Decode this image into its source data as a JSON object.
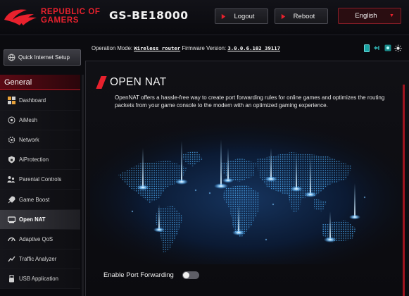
{
  "header": {
    "brand_line1": "REPUBLIC OF",
    "brand_line2": "GAMERS",
    "model": "GS-BE18000",
    "logout_label": "Logout",
    "reboot_label": "Reboot",
    "language": "English"
  },
  "status_bar": {
    "op_mode_label": "Operation Mode:",
    "op_mode_value": "Wireless router",
    "firmware_label": "Firmware Version:",
    "firmware_value": "3.0.0.6.102_39117",
    "icons": [
      "guest-network-icon",
      "usb-icon",
      "app-icon",
      "settings-sun-icon"
    ]
  },
  "sidebar": {
    "quick_setup": "Quick Internet Setup",
    "section_title": "General",
    "items": [
      {
        "label": "Dashboard",
        "icon": "dashboard-icon"
      },
      {
        "label": "AiMesh",
        "icon": "aimesh-icon"
      },
      {
        "label": "Network",
        "icon": "network-icon"
      },
      {
        "label": "AiProtection",
        "icon": "aiprotection-icon"
      },
      {
        "label": "Parental Controls",
        "icon": "parental-controls-icon"
      },
      {
        "label": "Game Boost",
        "icon": "game-boost-icon"
      },
      {
        "label": "Open NAT",
        "icon": "open-nat-icon",
        "active": true
      },
      {
        "label": "Adaptive QoS",
        "icon": "adaptive-qos-icon"
      },
      {
        "label": "Traffic Analyzer",
        "icon": "traffic-analyzer-icon"
      },
      {
        "label": "USB Application",
        "icon": "usb-application-icon"
      }
    ]
  },
  "main": {
    "title": "OPEN NAT",
    "description": "OpenNAT offers a hassle-free way to create port forwarding rules for online games and optimizes the routing packets from your game console to the modem with an optimized gaming experience.",
    "port_forwarding_label": "Enable Port Forwarding",
    "port_forwarding_enabled": false
  },
  "colors": {
    "accent": "#e8212d",
    "background": "#0b0b0f",
    "map_glow": "#3ea6ff"
  }
}
